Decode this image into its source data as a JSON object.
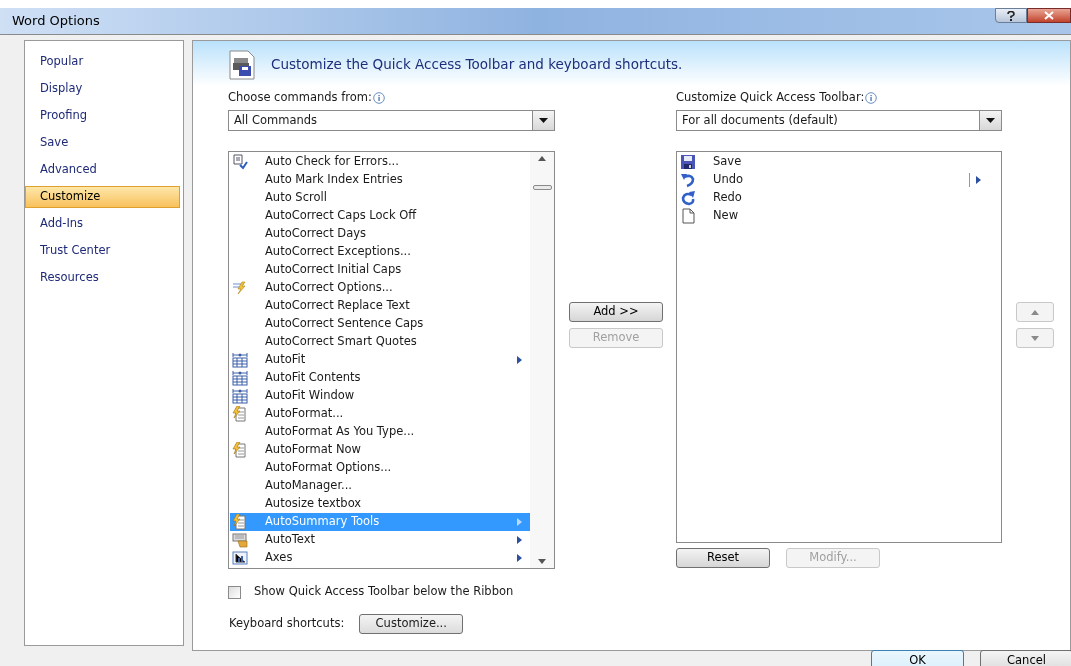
{
  "window": {
    "title": "Word Options"
  },
  "sidebar": {
    "items": [
      {
        "label": "Popular",
        "selected": false
      },
      {
        "label": "Display",
        "selected": false
      },
      {
        "label": "Proofing",
        "selected": false
      },
      {
        "label": "Save",
        "selected": false
      },
      {
        "label": "Advanced",
        "selected": false
      },
      {
        "label": "Customize",
        "selected": true
      },
      {
        "label": "Add-Ins",
        "selected": false
      },
      {
        "label": "Trust Center",
        "selected": false
      },
      {
        "label": "Resources",
        "selected": false
      }
    ]
  },
  "header": {
    "title": "Customize the Quick Access Toolbar and keyboard shortcuts."
  },
  "commands": {
    "label": "Choose commands from:",
    "dropdown": {
      "value": "All Commands"
    },
    "items": [
      {
        "label": "Auto Check for Errors...",
        "kind": "check",
        "submenu": false,
        "selected": false
      },
      {
        "label": "Auto Mark Index Entries",
        "submenu": false,
        "selected": false
      },
      {
        "label": "Auto Scroll",
        "submenu": false,
        "selected": false
      },
      {
        "label": "AutoCorrect Caps Lock Off",
        "submenu": false,
        "selected": false
      },
      {
        "label": "AutoCorrect Days",
        "submenu": false,
        "selected": false
      },
      {
        "label": "AutoCorrect Exceptions...",
        "submenu": false,
        "selected": false
      },
      {
        "label": "AutoCorrect Initial Caps",
        "submenu": false,
        "selected": false
      },
      {
        "label": "AutoCorrect Options...",
        "kind": "lightning",
        "submenu": false,
        "selected": false
      },
      {
        "label": "AutoCorrect Replace Text",
        "submenu": false,
        "selected": false
      },
      {
        "label": "AutoCorrect Sentence Caps",
        "submenu": false,
        "selected": false
      },
      {
        "label": "AutoCorrect Smart Quotes",
        "submenu": false,
        "selected": false
      },
      {
        "label": "AutoFit",
        "kind": "fit",
        "submenu": true,
        "selected": false
      },
      {
        "label": "AutoFit Contents",
        "kind": "fit",
        "submenu": false,
        "selected": false
      },
      {
        "label": "AutoFit Window",
        "kind": "fit",
        "submenu": false,
        "selected": false
      },
      {
        "label": "AutoFormat...",
        "kind": "format",
        "submenu": false,
        "selected": false
      },
      {
        "label": "AutoFormat As You Type...",
        "submenu": false,
        "selected": false
      },
      {
        "label": "AutoFormat Now",
        "kind": "format",
        "submenu": false,
        "selected": false
      },
      {
        "label": "AutoFormat Options...",
        "submenu": false,
        "selected": false
      },
      {
        "label": "AutoManager...",
        "submenu": false,
        "selected": false
      },
      {
        "label": "Autosize textbox",
        "submenu": false,
        "selected": false
      },
      {
        "label": "AutoSummary Tools",
        "kind": "format",
        "submenu": true,
        "selected": true
      },
      {
        "label": "AutoText",
        "kind": "autotext",
        "submenu": true,
        "selected": false
      },
      {
        "label": "Axes",
        "kind": "axes",
        "submenu": true,
        "selected": false
      }
    ]
  },
  "add_button": {
    "label": "Add >>",
    "disabled": false
  },
  "remove_button": {
    "label": "Remove",
    "disabled": true
  },
  "toolbar": {
    "label": "Customize Quick Access Toolbar:",
    "dropdown": {
      "value": "For all documents (default)"
    },
    "items": [
      {
        "label": "Save",
        "kind": "save",
        "submenu": false,
        "selected": false
      },
      {
        "label": "Undo",
        "kind": "undo",
        "submenu": true,
        "selected": false
      },
      {
        "label": "Redo",
        "kind": "redo",
        "submenu": false,
        "selected": false
      },
      {
        "label": "New",
        "kind": "new",
        "submenu": false,
        "selected": false
      }
    ]
  },
  "move_up_button": {
    "disabled": true
  },
  "move_down_button": {
    "disabled": true
  },
  "reset_button": {
    "label": "Reset",
    "disabled": false
  },
  "modify_button": {
    "label": "Modify...",
    "disabled": true
  },
  "show_below_ribbon": {
    "label": "Show Quick Access Toolbar below the Ribbon",
    "checked": false
  },
  "keyboard_shortcuts": {
    "label": "Keyboard shortcuts:",
    "button": "Customize..."
  },
  "footer": {
    "buttons": [
      {
        "label": "OK"
      },
      {
        "label": "Cancel"
      }
    ]
  }
}
